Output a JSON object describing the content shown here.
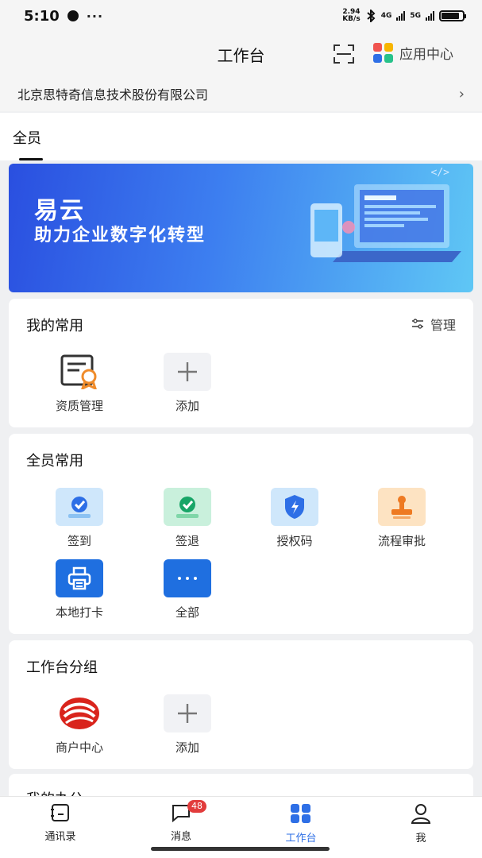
{
  "status_bar": {
    "time": "5:10",
    "more": "···",
    "net_speed_value": "2.94",
    "net_speed_unit": "KB/s",
    "sim1": "4G",
    "sim2": "5G",
    "battery_level": 0.85
  },
  "header": {
    "title": "工作台",
    "app_center_label": "应用中心"
  },
  "company": {
    "name": "北京思特奇信息技术股份有限公司"
  },
  "tabs": {
    "active_label": "全员"
  },
  "banner": {
    "line1": "易云",
    "line2": "助力企业数字化转型",
    "code_tag": "</>"
  },
  "my_common": {
    "title": "我的常用",
    "manage_label": "管理",
    "items": [
      {
        "label": "资质管理",
        "icon": "certificate-icon"
      },
      {
        "label": "添加",
        "icon": "plus-icon"
      }
    ]
  },
  "all_common": {
    "title": "全员常用",
    "items": [
      {
        "label": "签到",
        "icon": "check-in-icon"
      },
      {
        "label": "签退",
        "icon": "check-out-icon"
      },
      {
        "label": "授权码",
        "icon": "shield-icon"
      },
      {
        "label": "流程审批",
        "icon": "stamp-icon"
      },
      {
        "label": "本地打卡",
        "icon": "printer-icon"
      },
      {
        "label": "全部",
        "icon": "more-icon"
      }
    ]
  },
  "groups": {
    "title": "工作台分组",
    "items": [
      {
        "label": "商户中心",
        "icon": "merchant-logo-icon"
      },
      {
        "label": "添加",
        "icon": "plus-icon"
      }
    ]
  },
  "next_section_title": "我的办公",
  "bottom_nav": {
    "items": [
      {
        "label": "通讯录",
        "icon": "contacts-icon"
      },
      {
        "label": "消息",
        "icon": "message-icon",
        "badge": "48"
      },
      {
        "label": "工作台",
        "icon": "workbench-icon",
        "active": true
      },
      {
        "label": "我",
        "icon": "person-icon"
      }
    ]
  },
  "colors": {
    "accent": "#2e6fe6",
    "badge": "#e23c3c",
    "banner_start": "#2a4fe0",
    "banner_end": "#5fc7f5"
  }
}
